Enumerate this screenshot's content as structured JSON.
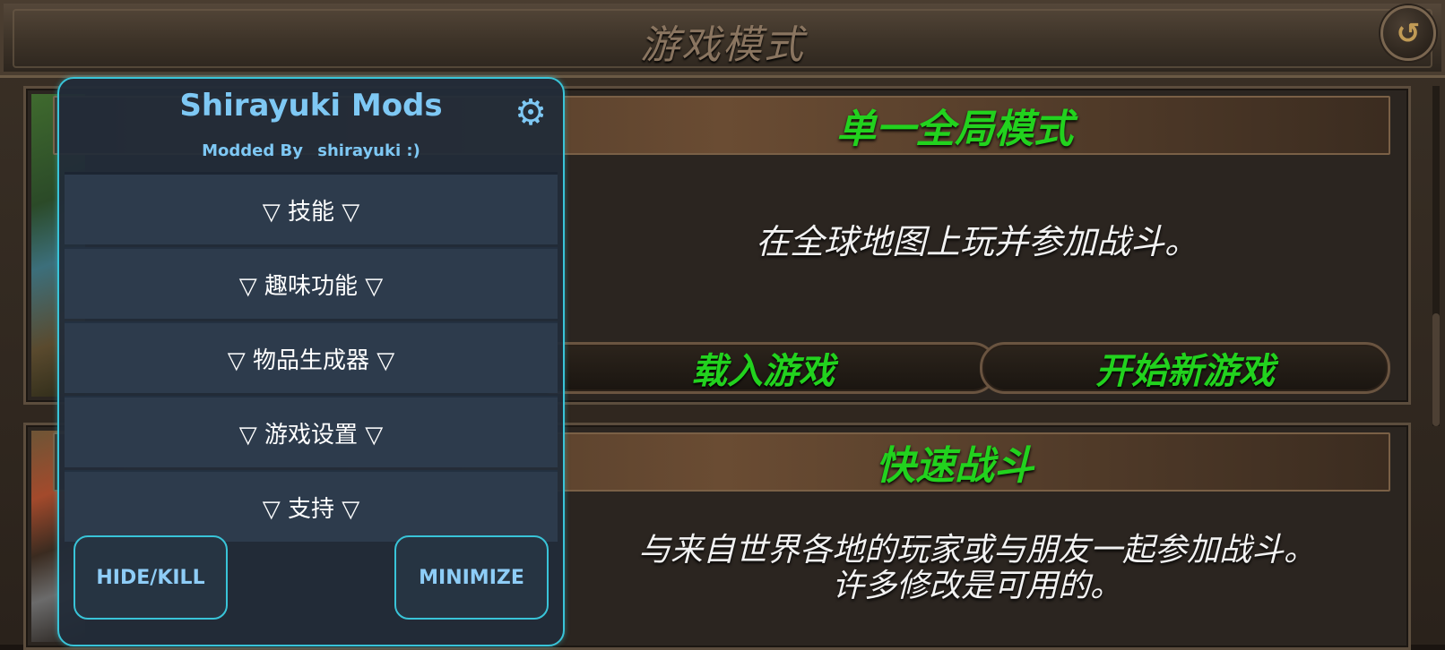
{
  "game": {
    "title": "游戏模式",
    "back_icon": "undo-icon",
    "modes": [
      {
        "name": "单一全局模式",
        "description": "在全球地图上玩并参加战斗。",
        "buttons": [
          "载入游戏",
          "开始新游戏"
        ]
      },
      {
        "name": "快速战斗",
        "description_lines": [
          "与来自世界各地的玩家或与朋友一起参加战斗。",
          "许多修改是可用的。"
        ]
      }
    ],
    "accent_color": "#22d21e"
  },
  "mod_menu": {
    "title": "Shirayuki Mods",
    "subtitle_prefix": "Modded By",
    "subtitle_name": "shirayuki",
    "subtitle_suffix": ":)",
    "settings_icon": "gear-icon",
    "items": [
      "▽ 技能 ▽",
      "▽ 趣味功能 ▽",
      "▽ 物品生成器 ▽",
      "▽ 游戏设置 ▽",
      "▽ 支持 ▽"
    ],
    "hide_label": "HIDE/KILL",
    "minimize_label": "MINIMIZE",
    "accent_color": "#39c4d8"
  }
}
